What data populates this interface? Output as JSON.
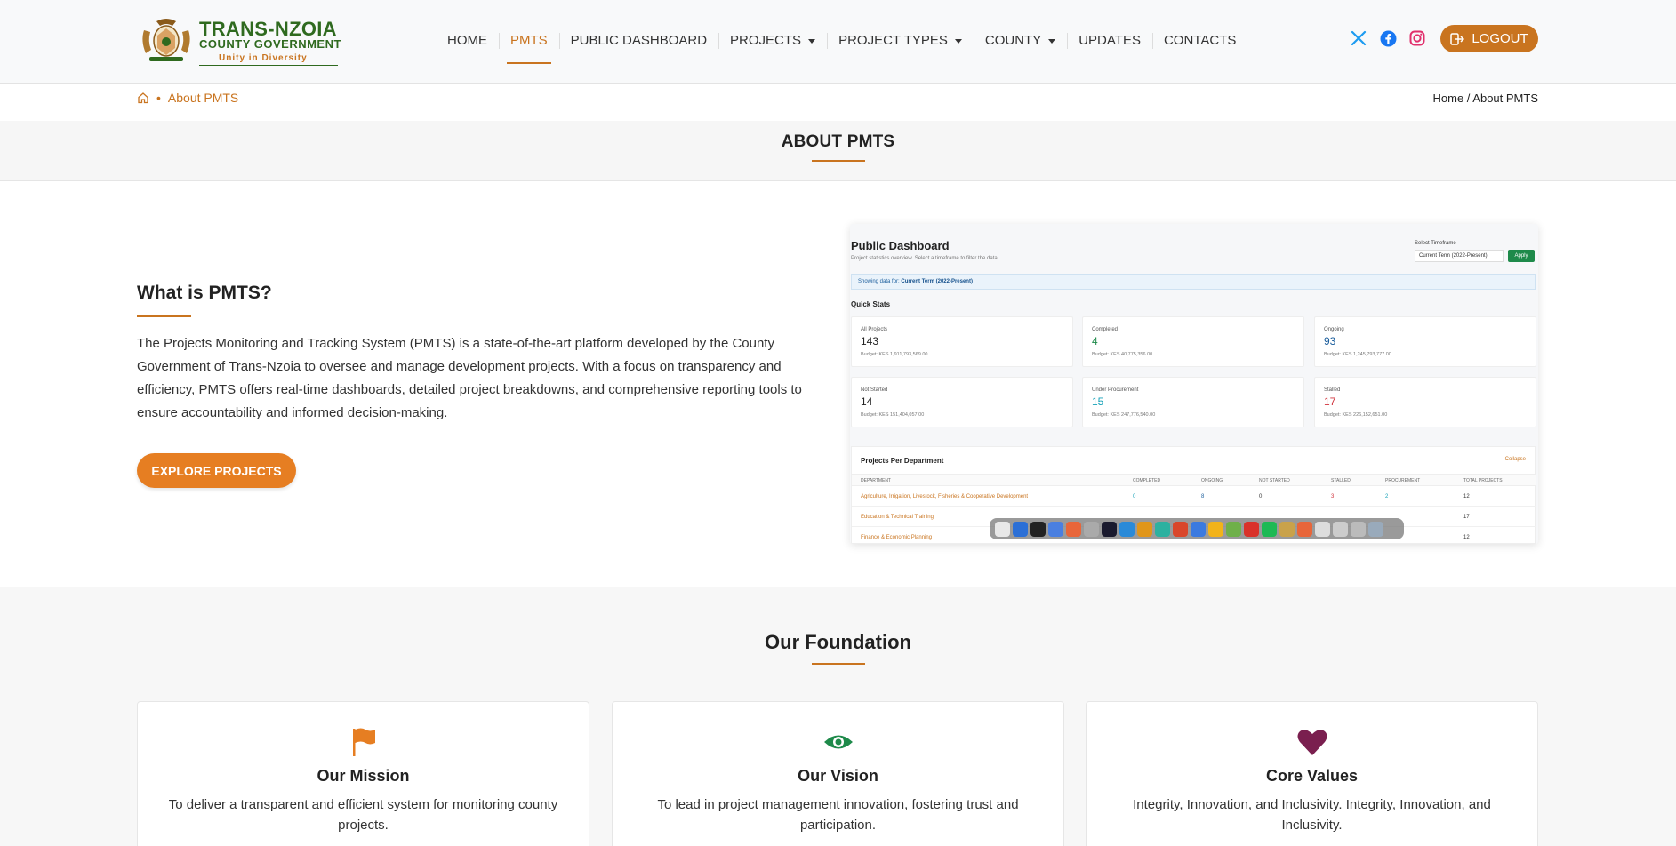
{
  "brand": {
    "line1": "TRANS-NZOIA",
    "line2": "COUNTY GOVERNMENT",
    "motto": "Unity in Diversity"
  },
  "nav": {
    "items": [
      {
        "label": "HOME"
      },
      {
        "label": "PMTS",
        "active": true
      },
      {
        "label": "PUBLIC DASHBOARD"
      },
      {
        "label": "PROJECTS",
        "dropdown": true
      },
      {
        "label": "PROJECT TYPES",
        "dropdown": true
      },
      {
        "label": "COUNTY",
        "dropdown": true
      },
      {
        "label": "UPDATES"
      },
      {
        "label": "CONTACTS"
      }
    ],
    "social": [
      "x-icon",
      "facebook-icon",
      "instagram-icon"
    ],
    "logout_label": "LOGOUT"
  },
  "breadcrumb": {
    "current": "About PMTS",
    "right": "Home / About PMTS"
  },
  "page": {
    "title": "ABOUT PMTS"
  },
  "about": {
    "heading": "What is PMTS?",
    "paragraph": "The Projects Monitoring and Tracking System (PMTS) is a state-of-the-art platform developed by the County Government of Trans-Nzoia to oversee and manage development projects. With a focus on transparency and efficiency, PMTS offers real-time dashboards, detailed project breakdowns, and comprehensive reporting tools to ensure accountability and informed decision-making.",
    "cta_label": "EXPLORE PROJECTS"
  },
  "preview": {
    "title": "Public Dashboard",
    "subtitle": "Project statistics overview. Select a timeframe to filter the data.",
    "timeframe_label": "Select Timeframe",
    "timeframe_value": "Current Term (2022-Present)",
    "apply_label": "Apply",
    "banner_prefix": "Showing data for:",
    "banner_value": "Current Term (2022-Present)",
    "quick_stats_title": "Quick Stats",
    "stats": [
      {
        "label": "All Projects",
        "value": "143",
        "budget": "Budget: KES 1,911,793,569.00",
        "color": "#222222"
      },
      {
        "label": "Completed",
        "value": "4",
        "budget": "Budget: KES 40,775,356.00",
        "color": "#1e8a4a"
      },
      {
        "label": "Ongoing",
        "value": "93",
        "budget": "Budget: KES 1,245,793,777.00",
        "color": "#1a5d9c"
      },
      {
        "label": "Not Started",
        "value": "14",
        "budget": "Budget: KES 151,404,057.00",
        "color": "#222222"
      },
      {
        "label": "Under Procurement",
        "value": "15",
        "budget": "Budget: KES 247,776,540.00",
        "color": "#17a2b8"
      },
      {
        "label": "Stalled",
        "value": "17",
        "budget": "Budget: KES 226,152,651.00",
        "color": "#d0323b"
      }
    ],
    "dept_title": "Projects Per Department",
    "collapse_label": "Collapse",
    "dept_headers": [
      "DEPARTMENT",
      "COMPLETED",
      "ONGOING",
      "NOT STARTED",
      "STALLED",
      "PROCUREMENT",
      "TOTAL PROJECTS"
    ],
    "dept_rows": [
      {
        "name": "Agriculture, Irrigation, Livestock, Fisheries & Cooperative Development",
        "completed": "0",
        "ongoing": "8",
        "not_started": "0",
        "stalled": "3",
        "procurement": "2",
        "total": "12"
      },
      {
        "name": "Education & Technical Training",
        "completed": "",
        "ongoing": "",
        "not_started": "",
        "stalled": "",
        "procurement": "",
        "total": "17"
      },
      {
        "name": "Finance & Economic Planning",
        "completed": "",
        "ongoing": "",
        "not_started": "",
        "stalled": "",
        "procurement": "",
        "total": "12"
      }
    ]
  },
  "foundation": {
    "heading": "Our Foundation",
    "cards": [
      {
        "icon": "flag-icon",
        "title": "Our Mission",
        "text": "To deliver a transparent and efficient system for monitoring county projects.",
        "color": "#e67e22"
      },
      {
        "icon": "eye-icon",
        "title": "Our Vision",
        "text": "To lead in project management innovation, fostering trust and participation.",
        "color": "#1e8a4a"
      },
      {
        "icon": "heart-icon",
        "title": "Core Values",
        "text": "Integrity, Innovation, and Inclusivity. Integrity, Innovation, and Inclusivity.",
        "color": "#7a1f4f"
      }
    ]
  },
  "colors": {
    "accent": "#c9741f",
    "button": "#e67e22",
    "brand_green": "#2f6a1f"
  }
}
